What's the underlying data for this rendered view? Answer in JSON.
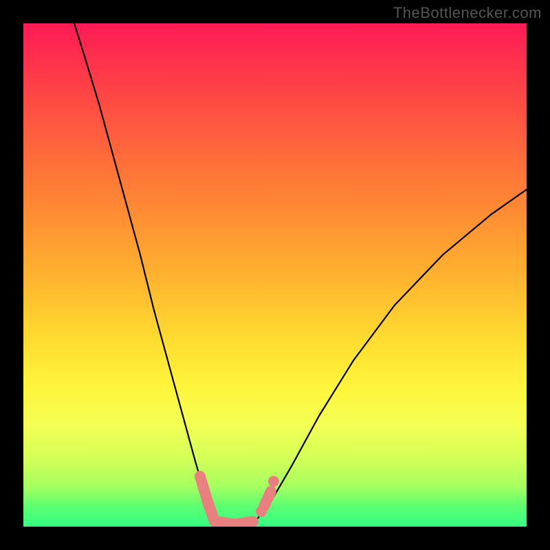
{
  "watermark": "TheBottlenecker.com",
  "chart_data": {
    "type": "line",
    "title": "",
    "xlabel": "",
    "ylabel": "",
    "x_range": [
      0,
      732
    ],
    "y_range_pct": [
      0,
      100
    ],
    "notes": "V-shaped bottleneck curve; y≈100 is worst (top, red), y≈0 is best (bottom, green). Curve reaches bottom around x≈280–340 where pink markers cluster.",
    "curve_points": [
      {
        "x": 74,
        "y": 100
      },
      {
        "x": 90,
        "y": 93
      },
      {
        "x": 110,
        "y": 84
      },
      {
        "x": 130,
        "y": 74
      },
      {
        "x": 150,
        "y": 64
      },
      {
        "x": 170,
        "y": 54
      },
      {
        "x": 190,
        "y": 43
      },
      {
        "x": 210,
        "y": 33
      },
      {
        "x": 230,
        "y": 23
      },
      {
        "x": 250,
        "y": 13
      },
      {
        "x": 265,
        "y": 6
      },
      {
        "x": 280,
        "y": 1.5
      },
      {
        "x": 300,
        "y": 0.5
      },
      {
        "x": 320,
        "y": 0.5
      },
      {
        "x": 340,
        "y": 1.5
      },
      {
        "x": 360,
        "y": 5
      },
      {
        "x": 390,
        "y": 12
      },
      {
        "x": 430,
        "y": 22
      },
      {
        "x": 480,
        "y": 33
      },
      {
        "x": 540,
        "y": 44
      },
      {
        "x": 610,
        "y": 54
      },
      {
        "x": 680,
        "y": 62
      },
      {
        "x": 732,
        "y": 67
      }
    ],
    "markers": [
      {
        "shape": "capsule",
        "x1": 257,
        "x2": 270,
        "y_pct_start": 10,
        "y_pct_end": 4
      },
      {
        "shape": "capsule",
        "x1": 268,
        "x2": 278,
        "y_pct_start": 5,
        "y_pct_end": 1
      },
      {
        "shape": "capsule",
        "x1": 282,
        "x2": 306,
        "y_pct_start": 1,
        "y_pct_end": 0.5
      },
      {
        "shape": "capsule",
        "x1": 308,
        "x2": 334,
        "y_pct_start": 0.5,
        "y_pct_end": 1
      },
      {
        "shape": "dot",
        "x": 346,
        "y_pct": 3
      },
      {
        "shape": "capsule",
        "x1": 350,
        "x2": 360,
        "y_pct_start": 4,
        "y_pct_end": 7
      },
      {
        "shape": "dot",
        "x": 364,
        "y_pct": 9
      }
    ],
    "marker_color": "#e98080",
    "curve_color": "#000000"
  }
}
